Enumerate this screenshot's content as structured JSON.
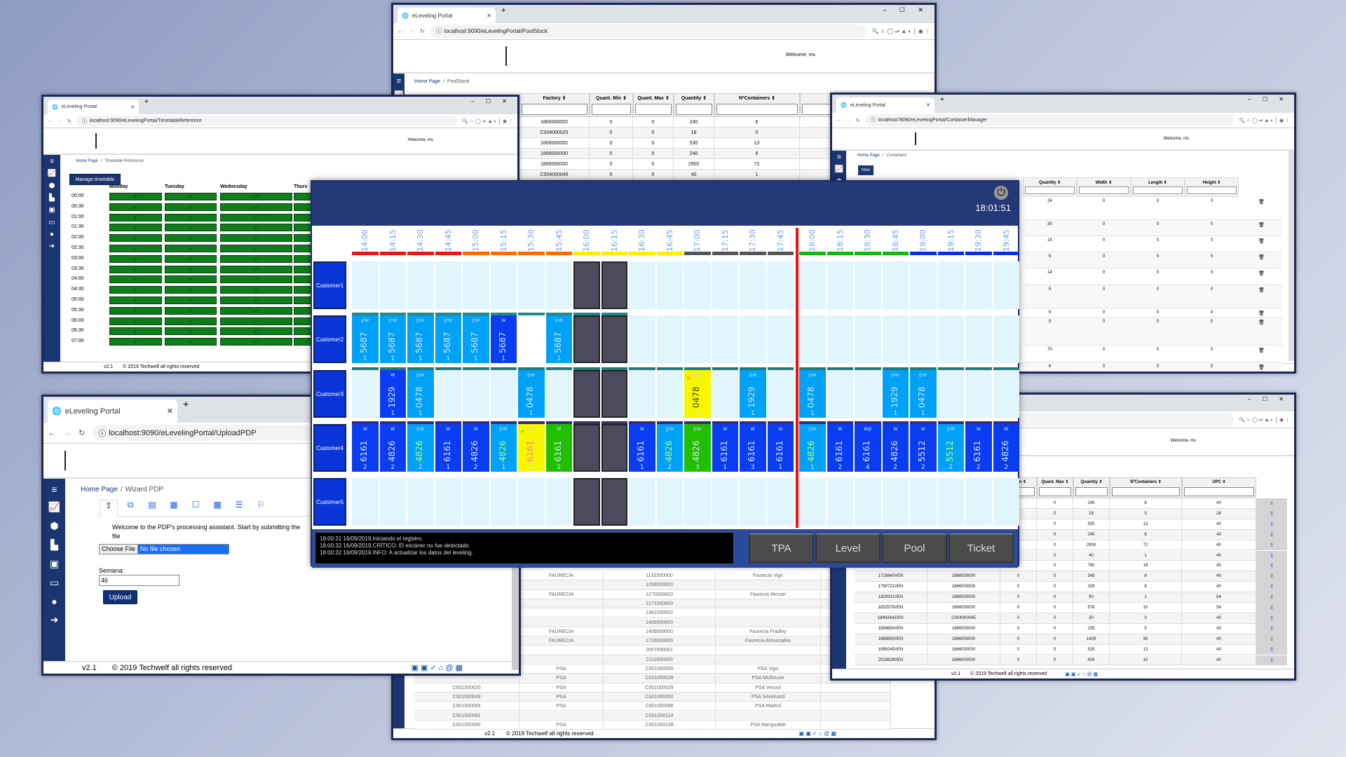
{
  "common": {
    "tab_title": "eLeveling Portal",
    "welcome": "Welcome, ms",
    "version": "v2.1",
    "copyright": "© 2019 Techwelf all rights reserved",
    "home": "Home Page",
    "sep": "/"
  },
  "pool_window": {
    "url": "localhost:9090/eLevelingPortal/PoolStock",
    "breadcrumb": "PoolStock",
    "columns": [
      "Factory ⇕",
      "Quant. Min ⇕",
      "Quant. Max ⇕",
      "Quantity ⇕",
      "NºContainers ⇕"
    ],
    "rows": [
      [
        "1866000000",
        "0",
        "0",
        "240",
        "6"
      ],
      [
        "C004000025",
        "0",
        "0",
        "18",
        "0"
      ],
      [
        "1866000000",
        "0",
        "0",
        "530",
        "13"
      ],
      [
        "1866000000",
        "0",
        "0",
        "240",
        "6"
      ],
      [
        "1866000000",
        "0",
        "0",
        "2900",
        "72"
      ],
      [
        "C004000045",
        "0",
        "0",
        "40",
        "1"
      ]
    ],
    "lower_rows": [
      [
        "",
        "FAURECIA",
        "1132000000",
        "Faurecia Vigo"
      ],
      [
        "",
        "",
        "1268000000",
        ""
      ],
      [
        "",
        "FAURECIA",
        "1270000000",
        "Faurecia Messei"
      ],
      [
        "",
        "",
        "1271000000",
        ""
      ],
      [
        "",
        "",
        "1361000000",
        ""
      ],
      [
        "",
        "",
        "1496000000",
        ""
      ],
      [
        "",
        "FAURECIA",
        "1499000000",
        "Faurecia Fradley"
      ],
      [
        "",
        "FAURECIA",
        "1728000000",
        "Faurecia Almussafes"
      ],
      [
        "",
        "",
        "2007000001",
        ""
      ],
      [
        "",
        "",
        "2110000000",
        ""
      ],
      [
        "",
        "PSA",
        "C001000005",
        "PSA Vigo"
      ],
      [
        "",
        "PSA",
        "C001000028",
        "PSA Mulhouse"
      ],
      [
        "C001000020",
        "PSA",
        "C001000029",
        "PSA Vesoul"
      ],
      [
        "C001000049",
        "PSA",
        "C001000052",
        "PSA Sevelnord"
      ],
      [
        "C001000056",
        "PSA",
        "C001000088",
        "PSA Madrid"
      ],
      [
        "C001000091",
        "",
        "C001000114",
        ""
      ],
      [
        "C001000090",
        "PSA",
        "C001000158",
        "PSA Mangualde"
      ]
    ]
  },
  "timetable_window": {
    "url": "localhost:9090/eLevelingPortal/TimetableReference",
    "breadcrumb": "Timetable Reference",
    "button": "Manage timetable",
    "days": [
      "Monday",
      "Tuesday",
      "Wednesday",
      "Thurs"
    ],
    "times": [
      "00:00",
      "00:30",
      "01:00",
      "01:30",
      "02:00",
      "02:30",
      "03:00",
      "03:30",
      "04:00",
      "04:30",
      "05:00",
      "05:30",
      "06:00",
      "06:30",
      "07:00"
    ],
    "check": "✓",
    "active_color": "#0f7d1c"
  },
  "container_window": {
    "url": "localhost:9090/eLevelingPortal/ContainerManager",
    "breadcrumb": "Containers",
    "new_button": "New",
    "columns": [
      "Quantity ⇕",
      "Width ⇕",
      "Length ⇕",
      "Height ⇕"
    ],
    "rows": [
      [
        "24",
        "0",
        "0",
        "0"
      ],
      [
        "30",
        "0",
        "0",
        "0"
      ],
      [
        "15",
        "0",
        "0",
        "0"
      ],
      [
        "6",
        "0",
        "0",
        "0"
      ],
      [
        "14",
        "0",
        "0",
        "0"
      ],
      [
        "5",
        "0",
        "0",
        "0"
      ],
      [
        "5",
        "0",
        "0",
        "0"
      ],
      [
        "5",
        "0",
        "0",
        "0"
      ],
      [
        "70",
        "0",
        "0",
        "0"
      ],
      [
        "6",
        "0",
        "0",
        "0"
      ]
    ]
  },
  "stock_window": {
    "columns": [
      "...Min ⇕",
      "Quant. Max ⇕",
      "Quantity ⇕",
      "NºContainers ⇕",
      "UPC ⇕"
    ],
    "rows": [
      [
        "",
        "",
        "0",
        "0",
        "240",
        "6",
        "40"
      ],
      [
        "",
        "",
        "0",
        "0",
        "18",
        "0",
        "24"
      ],
      [
        "",
        "",
        "0",
        "0",
        "530",
        "13",
        "40"
      ],
      [
        "",
        "",
        "0",
        "0",
        "240",
        "6",
        "40"
      ],
      [
        "",
        "",
        "0",
        "0",
        "2900",
        "72",
        "40"
      ],
      [
        "",
        "",
        "0",
        "0",
        "40",
        "1",
        "40"
      ],
      [
        "",
        "",
        "0",
        "0",
        "760",
        "19",
        "40"
      ],
      [
        "1725640VEN",
        "1866000000",
        "0",
        "0",
        "343",
        "8",
        "40"
      ],
      [
        "1790721VEN",
        "1866000000",
        "0",
        "0",
        "329",
        "8",
        "40"
      ],
      [
        "1829311VEN",
        "1866000000",
        "0",
        "0",
        "90",
        "1",
        "54"
      ],
      [
        "1832578VEN",
        "1866000000",
        "0",
        "0",
        "576",
        "10",
        "54"
      ],
      [
        "1849264200X",
        "C004000045",
        "0",
        "0",
        "30",
        "0",
        "40"
      ],
      [
        "1859654VEN",
        "1866000000",
        "0",
        "0",
        "209",
        "5",
        "40"
      ],
      [
        "1888850VEN",
        "1866000000",
        "0",
        "0",
        "1429",
        "35",
        "40"
      ],
      [
        "1899245VEN",
        "1866000000",
        "0",
        "0",
        "525",
        "13",
        "40"
      ],
      [
        "2015828VEN",
        "1866000000",
        "0",
        "0",
        "434",
        "10",
        "40"
      ]
    ]
  },
  "upload_window": {
    "url": "localhost:9090/eLevelingPortal/UploadPDP",
    "breadcrumb": "Wizard PDP",
    "welcome_text": "Welcome to the PDP's processing assistant. Start by submitting the file",
    "choose_file": "Choose File",
    "no_file": "No file chosen",
    "week_label": "Semana:",
    "week_value": "46",
    "upload_button": "Upload",
    "wizard_icons": [
      "file-upload-icon",
      "boxes-icon",
      "calendar-icon",
      "calendar-grid-icon",
      "calendar-blank-icon",
      "calendar-filled-icon",
      "list-icon",
      "flag-icon"
    ]
  },
  "leveling": {
    "clock": "18:01:51",
    "times": [
      "14:00",
      "14:15",
      "14:30",
      "14:45",
      "15:00",
      "15:15",
      "15:30",
      "15:45",
      "16:00",
      "16:15",
      "16:30",
      "16:45",
      "17:00",
      "17:15",
      "17:30",
      "17:45",
      "18:00",
      "18:15",
      "18:30",
      "18:45",
      "19:00",
      "19:15",
      "19:30",
      "19:45"
    ],
    "time_colors": [
      "#f01414",
      "#f01414",
      "#f01414",
      "#f01414",
      "#ff6a00",
      "#ff6a00",
      "#ff6a00",
      "#ff6a00",
      "#ffee00",
      "#ffee00",
      "#ffee00",
      "#ffee00",
      "#555555",
      "#555555",
      "#555555",
      "#555555",
      "#11b80f",
      "#11b80f",
      "#11b80f",
      "#11b80f",
      "#0b2cf0",
      "#0b2cf0",
      "#0b2cf0",
      "#0b2cf0"
    ],
    "current_time_after": "17:45",
    "colors": {
      "light": "#00a2f8",
      "dark": "#0a3cf2",
      "yellow": "#f7f700",
      "green": "#20c000",
      "blocked": "#4b4b5d",
      "empty": "#e1f5fd",
      "white": "#ffffff",
      "now_line": "#f01010"
    },
    "rows": [
      {
        "name": "Customer1",
        "stripe": "",
        "cells": [
          "",
          "",
          "",
          "",
          "",
          "",
          "",
          "",
          "X",
          "X",
          "",
          "",
          "",
          "",
          "",
          "",
          "",
          "",
          "",
          "",
          "",
          "",
          "",
          ""
        ]
      },
      {
        "name": "Customer2",
        "stripe": "#1f8a8a",
        "stripe_count": 10,
        "cells": [
          [
            "pw",
            "5687",
            "1",
            "light"
          ],
          [
            "pw",
            "5687",
            "1",
            "light"
          ],
          [
            "pw",
            "5687",
            "1",
            "light"
          ],
          [
            "pw",
            "5687",
            "1",
            "light"
          ],
          [
            "pw",
            "5687",
            "1",
            "light"
          ],
          [
            "w",
            "5687",
            "1",
            "dark"
          ],
          "W",
          [
            "pw",
            "5687",
            "1",
            "light"
          ],
          "X",
          "X",
          "",
          "",
          "",
          "",
          "",
          "",
          "",
          "",
          "",
          "",
          "",
          "",
          "",
          ""
        ]
      },
      {
        "name": "Customer3",
        "stripe": "#1f7a78",
        "stripe_count": 24,
        "cells": [
          "",
          [
            "w",
            "1929",
            "1",
            "dark"
          ],
          [
            "pw",
            "0478",
            "1",
            "light"
          ],
          "",
          "",
          "",
          [
            "pw",
            "0478",
            "1",
            "light"
          ],
          "",
          "X",
          "X",
          "",
          "",
          [
            "pw",
            "0478",
            "1",
            "yellow",
            "flame"
          ],
          "",
          [
            "pw",
            "1929",
            "1",
            "light"
          ],
          "",
          [
            "pw",
            "0478",
            "1",
            "light"
          ],
          "",
          "",
          [
            "pw",
            "1929",
            "1",
            "light"
          ],
          [
            "pw",
            "0478",
            "1",
            "light"
          ],
          "",
          "",
          ""
        ]
      },
      {
        "name": "Customer4",
        "stripe": "#3a2a78",
        "stripe_count": 24,
        "cells": [
          [
            "w",
            "6161",
            "2",
            "dark"
          ],
          [
            "w",
            "4826",
            "2",
            "dark"
          ],
          [
            "pw",
            "4826",
            "2",
            "light"
          ],
          [
            "w",
            "6161",
            "1",
            "dark"
          ],
          [
            "w",
            "4826",
            "2",
            "dark"
          ],
          [
            "pw",
            "4826",
            "1",
            "light"
          ],
          [
            "w",
            "6161",
            "2",
            "yellow",
            "check"
          ],
          [
            "w",
            "6161",
            "2",
            "green"
          ],
          "X",
          "X",
          [
            "w",
            "6161",
            "1",
            "dark"
          ],
          [
            "pw",
            "4826",
            "2",
            "light"
          ],
          [
            "pw",
            "4826",
            "3",
            "green"
          ],
          [
            "w",
            "6161",
            "1",
            "dark"
          ],
          [
            "w",
            "6161",
            "3",
            "dark"
          ],
          [
            "w",
            "6161",
            "1",
            "dark"
          ],
          [
            "pw",
            "4826",
            "1",
            "light"
          ],
          [
            "w",
            "6161",
            "2",
            "dark"
          ],
          [
            "wp",
            "6161",
            "4",
            "dark"
          ],
          [
            "w",
            "4826",
            "2",
            "dark"
          ],
          [
            "w",
            "5512",
            "2",
            "dark"
          ],
          [
            "pw",
            "5512",
            "2",
            "light"
          ],
          [
            "w",
            "6161",
            "2",
            "dark"
          ],
          [
            "w",
            "4826",
            "2",
            "dark"
          ]
        ]
      },
      {
        "name": "Customer5",
        "stripe": "",
        "cells": [
          "",
          "",
          "",
          "",
          "",
          "",
          "",
          "",
          "X",
          "X",
          "",
          "",
          "",
          "",
          "",
          "",
          "",
          "",
          "",
          "",
          "",
          "",
          "",
          ""
        ]
      }
    ],
    "log": [
      "18:00:31 16/09/2019.Iniciando el registro.",
      "18:00:32 16/09/2019.CRÍTICO: El escáner no fue detectado.",
      "18:00:32 16/09/2019.INFO: A actualizar los datos del leveling."
    ],
    "buttons": [
      "TPA",
      "Level",
      "Pool",
      "Ticket"
    ]
  }
}
